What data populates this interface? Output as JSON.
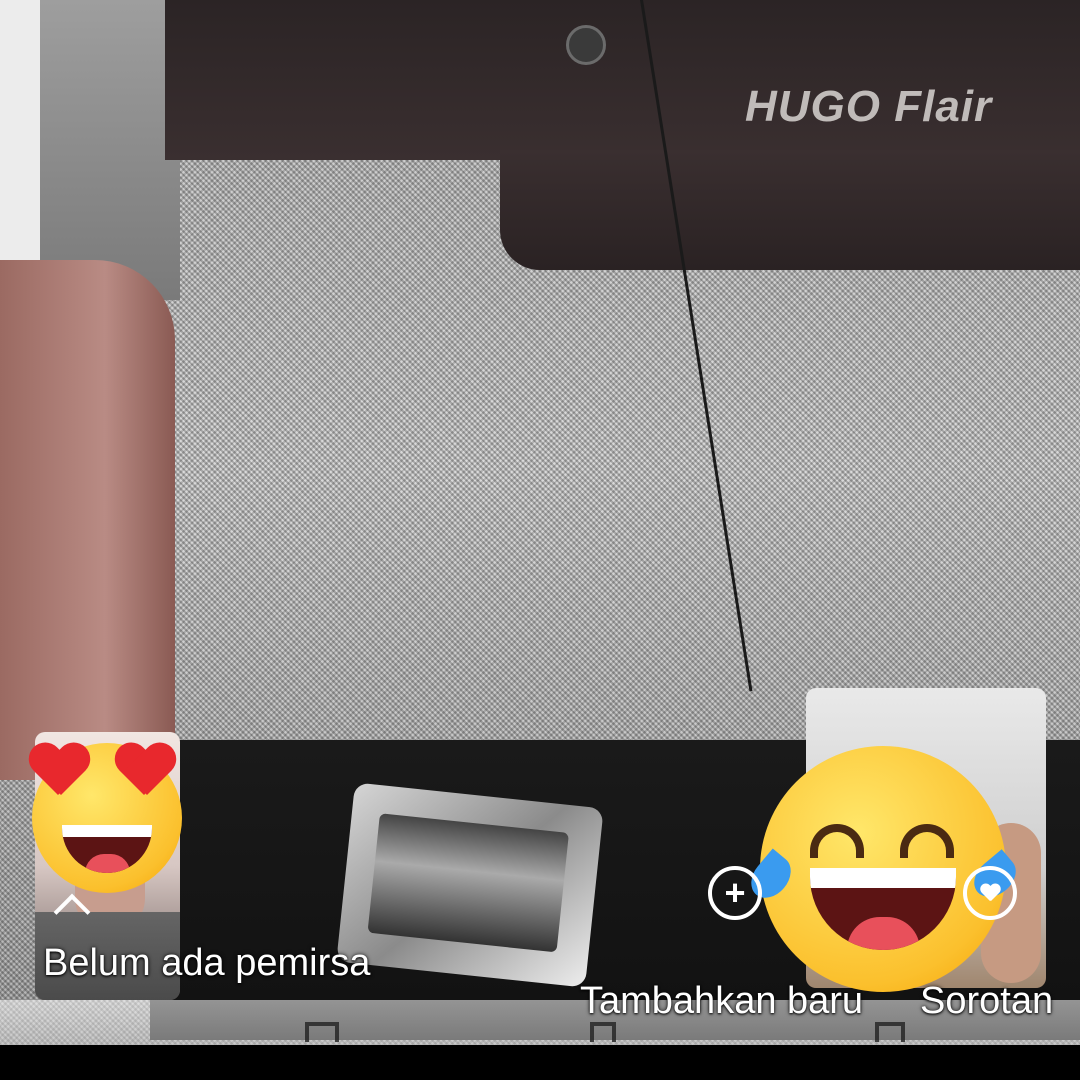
{
  "viewers": {
    "status": "Belum ada pemirsa"
  },
  "actions": {
    "add_new_label": "Tambahkan baru",
    "highlights_label": "Sorotan"
  },
  "reactions": [
    "heart-eyes-emoji",
    "tears-of-joy-emoji"
  ],
  "icons": {
    "expand": "chevron-up-icon",
    "add": "plus-circle-icon",
    "highlight": "heart-circle-icon"
  },
  "colors": {
    "overlay_text": "#ffffff"
  }
}
